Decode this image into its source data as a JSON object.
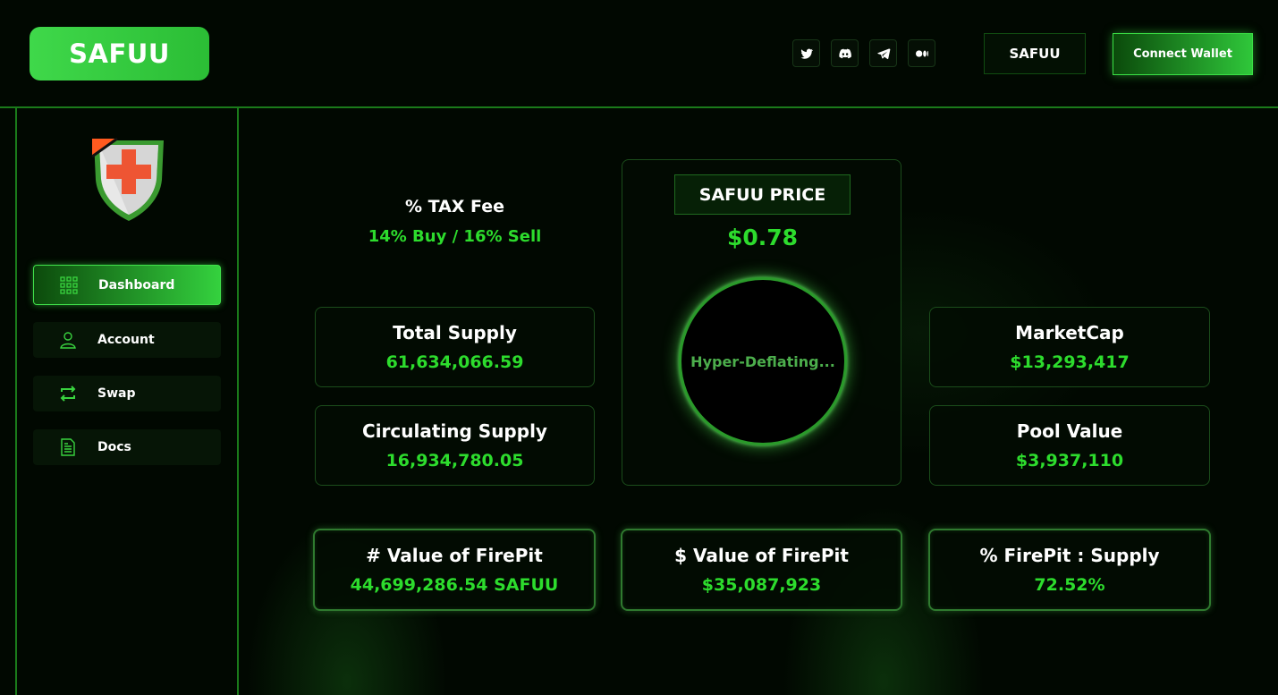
{
  "header": {
    "logo_text": "SAFUU",
    "socials": [
      {
        "name": "twitter-icon"
      },
      {
        "name": "discord-icon"
      },
      {
        "name": "telegram-icon"
      },
      {
        "name": "medium-icon"
      }
    ],
    "token_label": "SAFUU",
    "connect_label": "Connect Wallet"
  },
  "sidebar": {
    "items": [
      {
        "label": "Dashboard",
        "icon": "grid-icon",
        "active": true
      },
      {
        "label": "Account",
        "icon": "user-icon",
        "active": false
      },
      {
        "label": "Swap",
        "icon": "swap-icon",
        "active": false
      },
      {
        "label": "Docs",
        "icon": "document-icon",
        "active": false
      }
    ]
  },
  "dashboard": {
    "tax": {
      "label": "% TAX Fee",
      "value": "14% Buy / 16% Sell"
    },
    "price": {
      "label": "SAFUU PRICE",
      "value": "$0.78",
      "status": "Hyper-Deflating..."
    },
    "total_supply": {
      "label": "Total Supply",
      "value": "61,634,066.59"
    },
    "circulating_supply": {
      "label": "Circulating Supply",
      "value": "16,934,780.05"
    },
    "marketcap": {
      "label": "MarketCap",
      "value": "$13,293,417"
    },
    "pool_value": {
      "label": "Pool Value",
      "value": "$3,937,110"
    },
    "firepit_count": {
      "label": "# Value of FirePit",
      "value": "44,699,286.54 SAFUU"
    },
    "firepit_usd": {
      "label": "$ Value of FirePit",
      "value": "$35,087,923"
    },
    "firepit_ratio": {
      "label": "% FirePit : Supply",
      "value": "72.52%"
    }
  },
  "colors": {
    "accent": "#2ddc2d",
    "border": "#1a7a1a",
    "background": "#010801"
  }
}
